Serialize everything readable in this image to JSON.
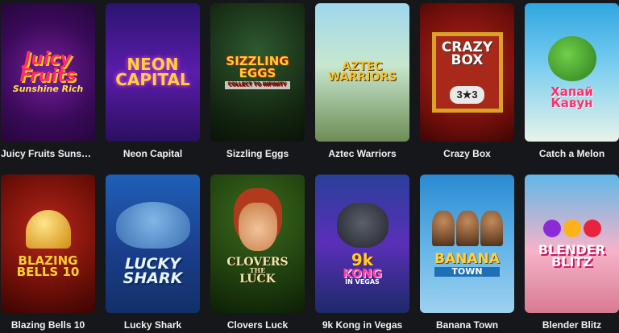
{
  "games": [
    {
      "title": "Juicy Fruits Sunsh...",
      "logo_lines": [
        "Juicy",
        "Fruits",
        "Sunshine Rich"
      ]
    },
    {
      "title": "Neon Capital",
      "logo_lines": [
        "NEON",
        "CAPITAL"
      ]
    },
    {
      "title": "Sizzling Eggs",
      "logo_lines": [
        "SIZZLING",
        "EGGS"
      ],
      "sub": "COLLECT TO INFINITY"
    },
    {
      "title": "Aztec Warriors",
      "logo_lines": [
        "AZTEC",
        "WARRIORS"
      ]
    },
    {
      "title": "Crazy Box",
      "logo_lines": [
        "CRAZY",
        "BOX"
      ],
      "mid": "3★3"
    },
    {
      "title": "Catch a Melon",
      "logo_lines": [
        "Хапай",
        "Кавун"
      ]
    },
    {
      "title": "Blazing Bells 10",
      "logo_lines": [
        "BLAZING",
        "BELLS 10"
      ]
    },
    {
      "title": "Lucky Shark",
      "logo_lines": [
        "LUCKY",
        "SHARK"
      ]
    },
    {
      "title": "Clovers Luck",
      "logo_lines": [
        "CLOVERS",
        "THE",
        "LUCK"
      ]
    },
    {
      "title": "9k Kong in Vegas",
      "logo_lines": [
        "9k",
        "KONG",
        "IN VEGAS"
      ]
    },
    {
      "title": "Banana Town",
      "logo_lines": [
        "BANANA",
        "TOWN"
      ]
    },
    {
      "title": "Blender Blitz",
      "logo_lines": [
        "BLENDER",
        "BLITZ"
      ]
    }
  ],
  "colors": {
    "background": "#16171b",
    "title_text": "#f2f2f2"
  }
}
